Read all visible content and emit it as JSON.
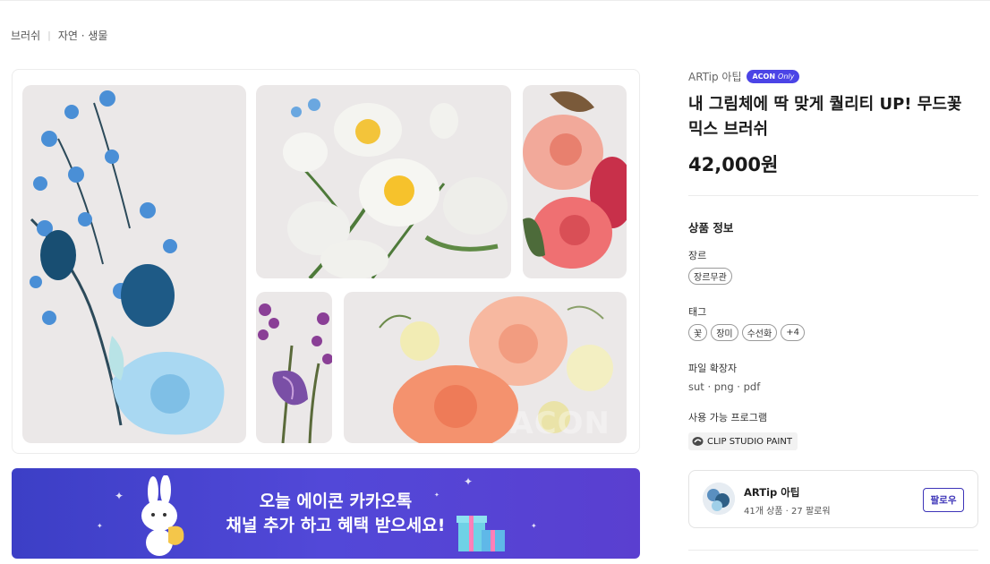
{
  "breadcrumb": {
    "items": [
      "브러쉬",
      "자연 · 생물"
    ]
  },
  "gallery": {
    "watermark": "ACON"
  },
  "banner": {
    "line1": "오늘 에이콘 카카오톡",
    "line2": "채널 추가 하고 혜택 받으세요!"
  },
  "product": {
    "brand": "ARTip 아팁",
    "badge": {
      "text": "ACON",
      "sub": "Only"
    },
    "title": "내 그림체에 딱 맞게 퀄리티 UP! 무드꽃 믹스 브러쉬",
    "price": "42,000원"
  },
  "info": {
    "section_title": "상품 정보",
    "genre_label": "장르",
    "genre_chips": [
      "장르무관"
    ],
    "tags_label": "태그",
    "tag_chips": [
      "꽃",
      "장미",
      "수선화",
      "+4"
    ],
    "ext_label": "파일 확장자",
    "extensions": "sut · png · pdf",
    "program_label": "사용 가능 프로그램",
    "program": "CLIP STUDIO PAINT"
  },
  "seller": {
    "name": "ARTip 아팁",
    "meta": "41개 상품 · 27 팔로워",
    "follow_label": "팔로우"
  },
  "colors": {
    "accent": "#4b44e6",
    "banner_start": "#3c3fc6",
    "banner_end": "#5a3fd0",
    "follow": "#3d34b8"
  },
  "icons": {
    "program": "clip-studio-icon",
    "sparkle": "sparkle-icon"
  }
}
